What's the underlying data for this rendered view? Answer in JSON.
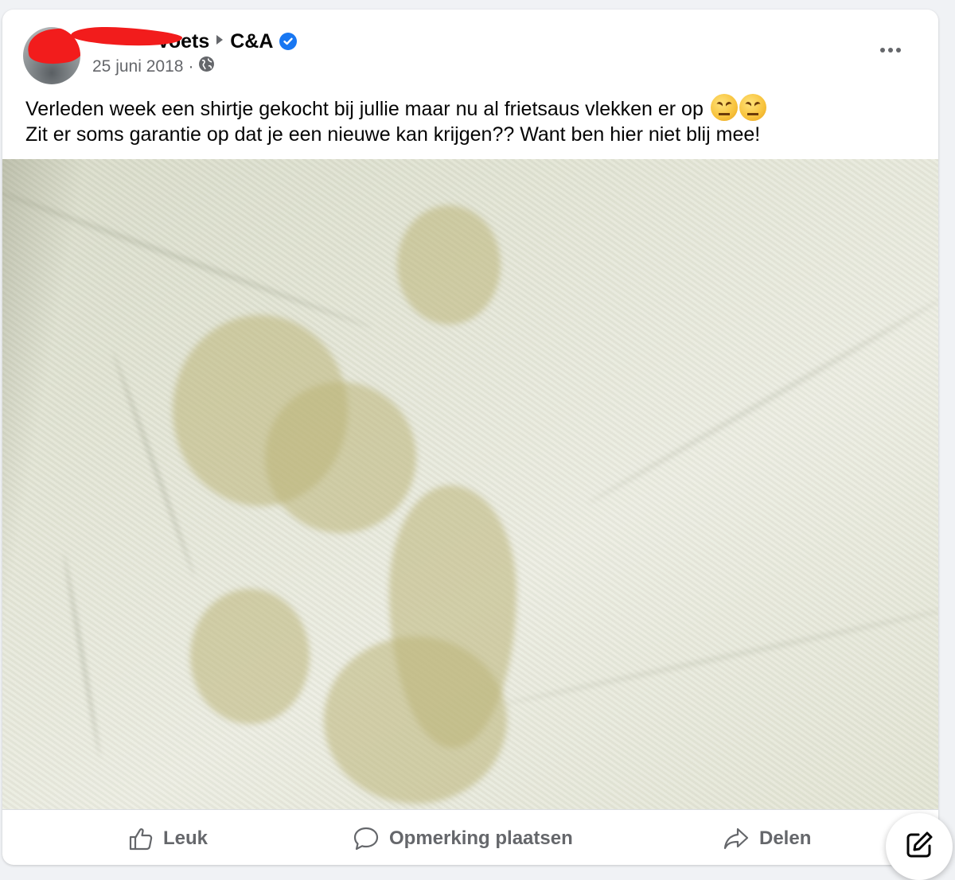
{
  "post": {
    "author": {
      "name_visible": "Voets",
      "target_page": "C&A"
    },
    "date": "25 juni 2018",
    "separator": "·",
    "text_line1": "Verleden week een shirtje gekocht bij jullie maar nu al frietsaus vlekken er op",
    "text_line2": "Zit er soms garantie op dat je een nieuwe kan krijgen?? Want ben hier niet blij mee!",
    "emojis": [
      "confounded-face-emoji",
      "confounded-face-emoji"
    ]
  },
  "actions": {
    "like_label": "Leuk",
    "comment_label": "Opmerking plaatsen",
    "share_label": "Delen"
  },
  "colors": {
    "text": "#050505",
    "secondary": "#65676b",
    "verified": "#1877f2",
    "redaction": "#f21c1c",
    "background": "#f0f2f5"
  }
}
